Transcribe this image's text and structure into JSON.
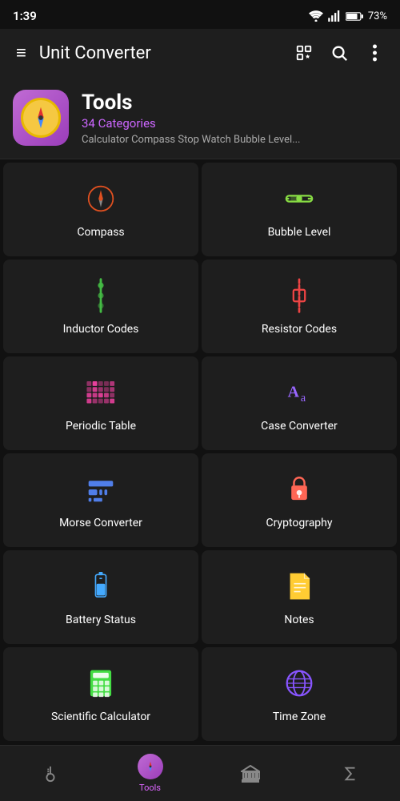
{
  "statusBar": {
    "time": "1:39",
    "battery": "73%"
  },
  "appBar": {
    "title": "Unit Converter",
    "menuIcon": "≡",
    "searchIcon": "🔍",
    "moreIcon": "⋮"
  },
  "header": {
    "title": "Tools",
    "subtitle": "34 Categories",
    "description": "Calculator Compass Stop Watch Bubble Level..."
  },
  "grid": [
    {
      "id": "compass",
      "label": "Compass",
      "iconColor": "#e05020",
      "iconType": "compass"
    },
    {
      "id": "bubble-level",
      "label": "Bubble Level",
      "iconColor": "#88dd44",
      "iconType": "bubble"
    },
    {
      "id": "inductor-codes",
      "label": "Inductor Codes",
      "iconColor": "#44bb44",
      "iconType": "inductor"
    },
    {
      "id": "resistor-codes",
      "label": "Resistor Codes",
      "iconColor": "#ee4444",
      "iconType": "resistor"
    },
    {
      "id": "periodic-table",
      "label": "Periodic Table",
      "iconColor": "#ff44aa",
      "iconType": "periodic"
    },
    {
      "id": "case-converter",
      "label": "Case Converter",
      "iconColor": "#9966ff",
      "iconType": "case"
    },
    {
      "id": "morse-converter",
      "label": "Morse Converter",
      "iconColor": "#5588ff",
      "iconType": "morse"
    },
    {
      "id": "cryptography",
      "label": "Cryptography",
      "iconColor": "#ff6655",
      "iconType": "crypto"
    },
    {
      "id": "battery-status",
      "label": "Battery Status",
      "iconColor": "#44aaff",
      "iconType": "battery"
    },
    {
      "id": "notes",
      "label": "Notes",
      "iconColor": "#ffcc33",
      "iconType": "notes"
    },
    {
      "id": "scientific-calculator",
      "label": "Scientific Calculator",
      "iconColor": "#44dd44",
      "iconType": "calculator"
    },
    {
      "id": "time-zone",
      "label": "Time Zone",
      "iconColor": "#8855ff",
      "iconType": "globe"
    }
  ],
  "bottomNav": [
    {
      "id": "thermometer",
      "icon": "thermometer",
      "label": "",
      "active": false
    },
    {
      "id": "tools",
      "icon": "compass",
      "label": "Tools",
      "active": true
    },
    {
      "id": "bank",
      "icon": "bank",
      "label": "",
      "active": false
    },
    {
      "id": "sigma",
      "icon": "sigma",
      "label": "",
      "active": false
    }
  ]
}
